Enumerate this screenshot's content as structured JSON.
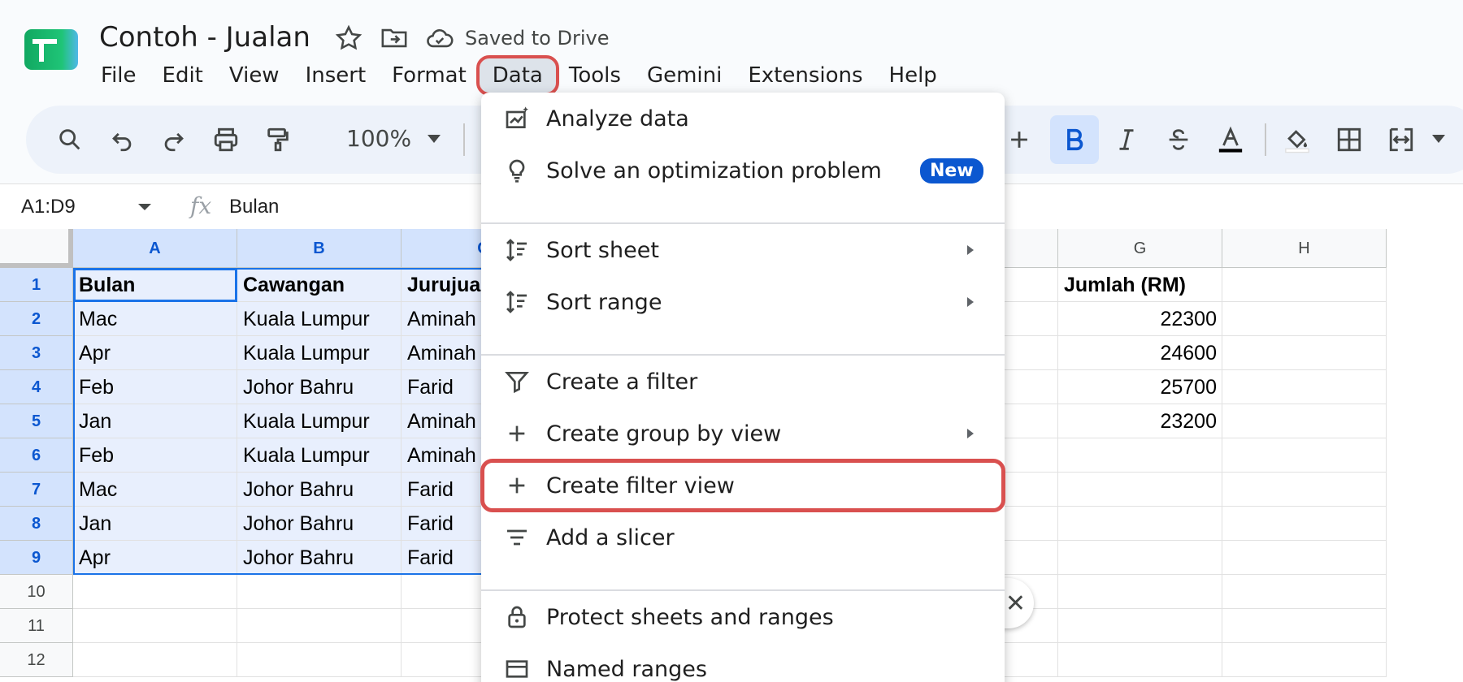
{
  "app": {
    "doc_title": "Contoh - Jualan",
    "saved_status": "Saved to Drive",
    "brand_color": "#0f9d58"
  },
  "menubar": {
    "items": [
      "File",
      "Edit",
      "View",
      "Insert",
      "Format",
      "Data",
      "Tools",
      "Gemini",
      "Extensions",
      "Help"
    ],
    "active": "Data"
  },
  "toolbar": {
    "zoom": "100%",
    "currency": "$"
  },
  "formula_bar": {
    "name_box": "A1:D9",
    "fx": "fx",
    "content": "Bulan"
  },
  "grid": {
    "columns": [
      "A",
      "B",
      "C",
      "",
      "",
      "",
      "G",
      "H"
    ],
    "rows": [
      "1",
      "2",
      "3",
      "4",
      "5",
      "6",
      "7",
      "8",
      "9",
      "10",
      "11",
      "12"
    ],
    "col_a": [
      "Bulan",
      "Mac",
      "Apr",
      "Feb",
      "Jan",
      "Feb",
      "Mac",
      "Jan",
      "Apr"
    ],
    "col_b": [
      "Cawangan",
      "Kuala Lumpur",
      "Kuala Lumpur",
      "Johor Bahru",
      "Kuala Lumpur",
      "Kuala Lumpur",
      "Johor Bahru",
      "Johor Bahru",
      "Johor Bahru"
    ],
    "col_c": [
      "Jurujua",
      "Aminah",
      "Aminah",
      "Farid",
      "Aminah",
      "Aminah",
      "Farid",
      "Farid",
      "Farid"
    ],
    "col_g": [
      "Jumlah (RM)",
      "22300",
      "24600",
      "25700",
      "23200",
      "",
      "",
      "",
      ""
    ]
  },
  "dropdown": {
    "items": [
      {
        "label": "Analyze data",
        "icon": "analyze-icon"
      },
      {
        "label": "Solve an optimization problem",
        "icon": "lightbulb-icon",
        "badge": "New"
      },
      {
        "label": "Sort sheet",
        "icon": "sort-icon",
        "submenu": true
      },
      {
        "label": "Sort range",
        "icon": "sort-icon",
        "submenu": true
      },
      {
        "label": "Create a filter",
        "icon": "filter-icon"
      },
      {
        "label": "Create group by view",
        "icon": "plus-icon",
        "submenu": true
      },
      {
        "label": "Create filter view",
        "icon": "plus-icon",
        "highlighted": true
      },
      {
        "label": "Add a slicer",
        "icon": "slicer-icon"
      },
      {
        "label": "Protect sheets and ranges",
        "icon": "lock-icon"
      },
      {
        "label": "Named ranges",
        "icon": "named-ranges-icon"
      }
    ]
  },
  "colors": {
    "highlight_outline": "#d9504f",
    "selection_fill": "#e8effd",
    "selection_border": "#1a73e8",
    "badge_blue": "#0b57d0"
  }
}
